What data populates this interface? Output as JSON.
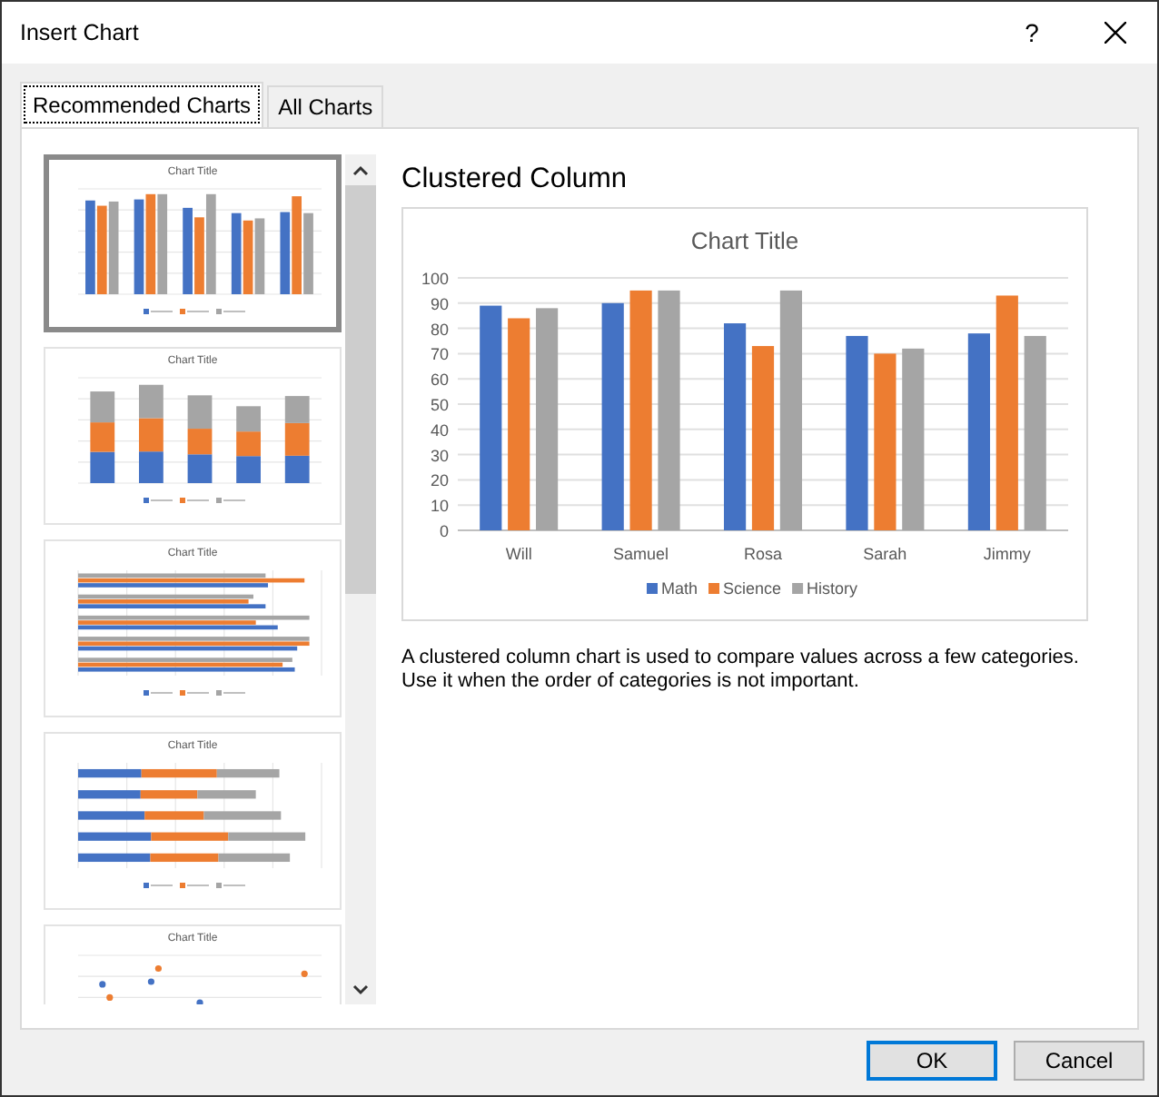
{
  "window": {
    "title": "Insert Chart",
    "help": "?"
  },
  "tabs": [
    {
      "label": "Recommended Charts",
      "selected": true
    },
    {
      "label": "All Charts",
      "selected": false
    }
  ],
  "thumbnails": [
    {
      "kind": "clustered_column",
      "title": "Chart Title",
      "selected": true
    },
    {
      "kind": "stacked_column",
      "title": "Chart Title",
      "selected": false
    },
    {
      "kind": "clustered_bar",
      "title": "Chart Title",
      "selected": false
    },
    {
      "kind": "stacked_bar",
      "title": "Chart Title",
      "selected": false
    },
    {
      "kind": "scatter",
      "title": "Chart Title",
      "selected": false
    }
  ],
  "preview": {
    "heading": "Clustered Column",
    "chart_data": {
      "type": "bar",
      "title": "Chart Title",
      "categories": [
        "Will",
        "Samuel",
        "Rosa",
        "Sarah",
        "Jimmy"
      ],
      "series": [
        {
          "name": "Math",
          "color": "#4472c4",
          "values": [
            89,
            90,
            82,
            77,
            78
          ]
        },
        {
          "name": "Science",
          "color": "#ed7d31",
          "values": [
            84,
            95,
            73,
            70,
            93
          ]
        },
        {
          "name": "History",
          "color": "#a5a5a5",
          "values": [
            88,
            95,
            95,
            72,
            77
          ]
        }
      ],
      "grid": true,
      "legend": true,
      "ylim": [
        0,
        100
      ],
      "yticks": [
        0,
        10,
        20,
        30,
        40,
        50,
        60,
        70,
        80,
        90,
        100
      ]
    },
    "description": "A clustered column chart is used to compare values across a few categories. Use it when the order of categories is not important."
  },
  "buttons": [
    {
      "label": "OK",
      "kind": "primary"
    },
    {
      "label": "Cancel",
      "kind": "secondary"
    }
  ]
}
